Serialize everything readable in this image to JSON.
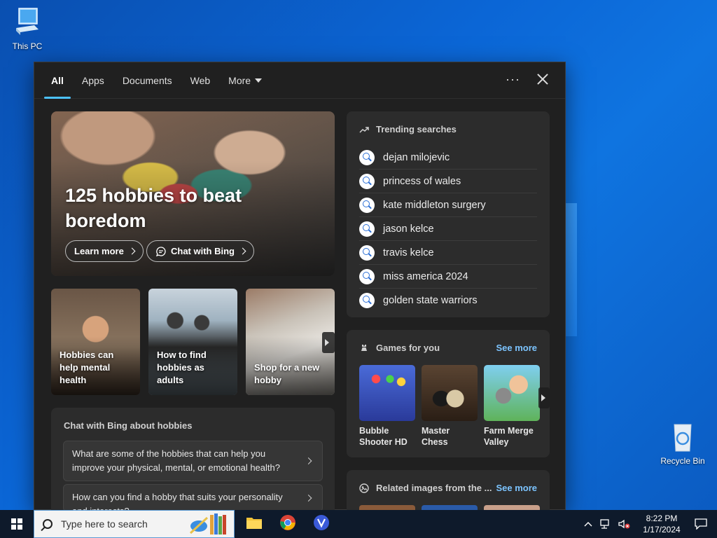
{
  "desktop": {
    "icons": [
      {
        "label": "This PC"
      },
      {
        "label": "Recycle Bin"
      }
    ]
  },
  "panel": {
    "tabs": [
      {
        "label": "All",
        "active": true
      },
      {
        "label": "Apps"
      },
      {
        "label": "Documents"
      },
      {
        "label": "Web"
      },
      {
        "label": "More"
      }
    ],
    "more_options_label": "···",
    "hero": {
      "title": "125 hobbies to beat boredom",
      "learn_more": "Learn more",
      "chat_with_bing": "Chat with Bing"
    },
    "cards": [
      {
        "label": "Hobbies can help mental health"
      },
      {
        "label": "How to find hobbies as adults"
      },
      {
        "label": "Shop for a new hobby"
      }
    ],
    "chat": {
      "heading": "Chat with Bing about hobbies",
      "questions": [
        "What are some of the hobbies that can help you improve your physical, mental, or emotional health?",
        "How can you find a hobby that suits your personality and interests?"
      ]
    },
    "trending": {
      "heading": "Trending searches",
      "items": [
        "dejan milojevic",
        "princess of wales",
        "kate middleton surgery",
        "jason kelce",
        "travis kelce",
        "miss america 2024",
        "golden state warriors"
      ]
    },
    "games": {
      "heading": "Games for you",
      "see_more": "See more",
      "items": [
        {
          "label": "Bubble Shooter HD"
        },
        {
          "label": "Master Chess"
        },
        {
          "label": "Farm Merge Valley"
        }
      ]
    },
    "related": {
      "heading": "Related images from the ...",
      "see_more": "See more"
    }
  },
  "taskbar": {
    "search_placeholder": "Type here to search",
    "time": "8:22 PM",
    "date": "1/17/2024"
  },
  "colors": {
    "accent": "#4cc2ff",
    "link": "#7cc4ff",
    "panel_bg": "#202020",
    "card_bg": "#2c2c2c"
  }
}
